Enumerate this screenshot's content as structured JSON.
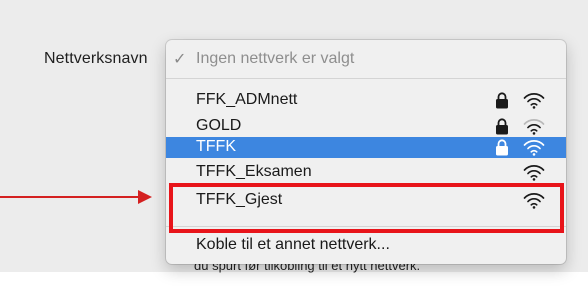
{
  "settings": {
    "network_name_label": "Nettverksnavn"
  },
  "menu": {
    "checkmark": "✓",
    "none_selected": "Ingen nettverk er valgt",
    "networks": [
      {
        "name": "FFK_ADMnett",
        "locked": true,
        "signal": "full"
      },
      {
        "name": "GOLD",
        "locked": true,
        "signal": "weak"
      },
      {
        "name": "TFFK",
        "locked": true,
        "signal": "full",
        "selected": true
      },
      {
        "name": "TFFK_Eksamen",
        "locked": false,
        "signal": "full"
      },
      {
        "name": "TFFK_Gjest",
        "locked": false,
        "signal": "full",
        "highlighted": true
      }
    ],
    "other_network": "Koble til et annet nettverk..."
  },
  "background_text": "du spurt før tilkobling til et nytt nettverk.",
  "icons": {
    "lock": "lock-icon",
    "wifi": "wifi-icon"
  },
  "colors": {
    "selection": "#3d86e0",
    "annotation": "#e8141a"
  }
}
